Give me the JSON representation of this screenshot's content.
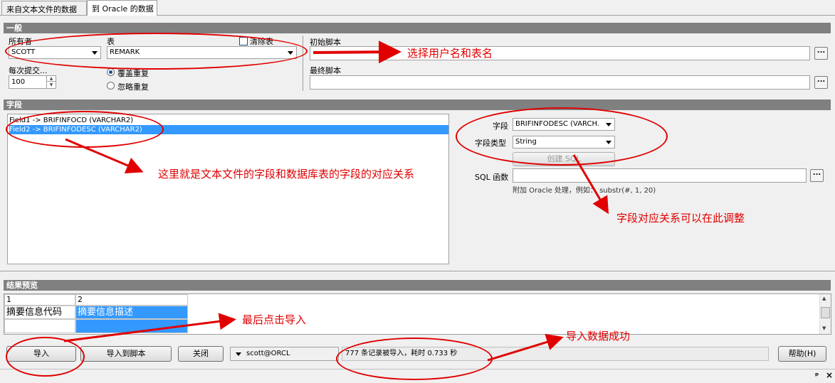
{
  "tabs": [
    {
      "label": "来自文本文件的数据"
    },
    {
      "label": "到 Oracle 的数据"
    }
  ],
  "general": {
    "header": "一般",
    "owner_label": "所有者",
    "owner_value": "SCOTT",
    "table_label": "表",
    "table_value": "REMARK",
    "clear_table_label": "清除表",
    "commit_label": "每次提交...",
    "commit_value": "100",
    "overwrite_label": "覆盖重复",
    "ignore_label": "忽略重复",
    "init_script_label": "初始脚本",
    "final_script_label": "最终脚本",
    "dots": "..."
  },
  "fields": {
    "header": "字段",
    "mappings": [
      {
        "text": "Field1  ->  BRIFINFOCD (VARCHAR2)"
      },
      {
        "text": "Field2  ->  BRIFINFODESC (VARCHAR2)"
      }
    ],
    "field_label": "字段",
    "field_value": "BRIFINFODESC (VARCH.",
    "type_label": "字段类型",
    "type_value": "String",
    "create_sql_button": "创建 SQL",
    "sql_func_label": "SQL 函数",
    "hint_text": "附加 Oracle 处理，例如：  substr(#, 1, 20)"
  },
  "preview": {
    "header": "结果预览",
    "columns": [
      "1",
      "2"
    ],
    "row1": [
      "摘要信息代码",
      "摘要信息描述"
    ]
  },
  "bottom": {
    "import_button": "导入",
    "import_script_button": "导入到脚本",
    "close_button": "关闭",
    "connection": "scott@ORCL",
    "status": "777 条记录被导入，耗时 0.733 秒",
    "help_button": "帮助(H)",
    "pin": "ᵖ",
    "close_x": "×"
  },
  "annotations": {
    "a1": "选择用户名和表名",
    "a2": "这里就是文本文件的字段和数据库表的字段的对应关系",
    "a3": "字段对应关系可以在此调整",
    "a4": "最后点击导入",
    "a5": "导入数据成功"
  },
  "colors": {
    "annotation": "#e00000",
    "section_header": "#808080",
    "selection": "#3399ff"
  }
}
